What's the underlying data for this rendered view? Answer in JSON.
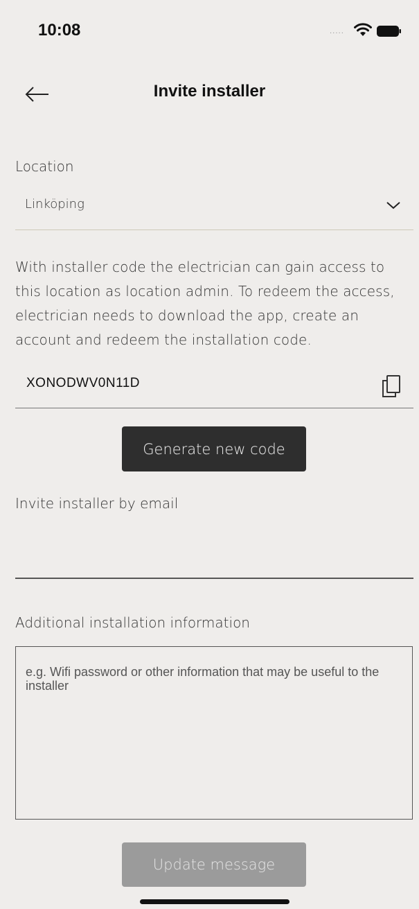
{
  "status_bar": {
    "time": "10:08",
    "signal_dots": "....."
  },
  "header": {
    "title": "Invite installer",
    "back_icon": "arrow-left-icon"
  },
  "location": {
    "label": "Location",
    "selected": "Linköping",
    "icon": "chevron-down-icon"
  },
  "info_text": "With installer code the electrician can gain access to this location as location admin. To redeem the access, electrician needs to download the app, create an account and redeem the installation code.",
  "installer_code": {
    "value": "XONODWV0N11D",
    "copy_icon": "copy-icon"
  },
  "generate_button_label": "Generate new code",
  "email": {
    "label": "Invite installer by email",
    "value": ""
  },
  "additional_info": {
    "label": "Additional installation information",
    "placeholder": "e.g. Wifi password or other information that may be useful to the installer"
  },
  "update_button_label": "Update message",
  "colors": {
    "background": "#efedeb",
    "primary_button": "#2e2e2e",
    "disabled_button": "#9b9b9b",
    "location_divider": "#cdc9b8"
  }
}
